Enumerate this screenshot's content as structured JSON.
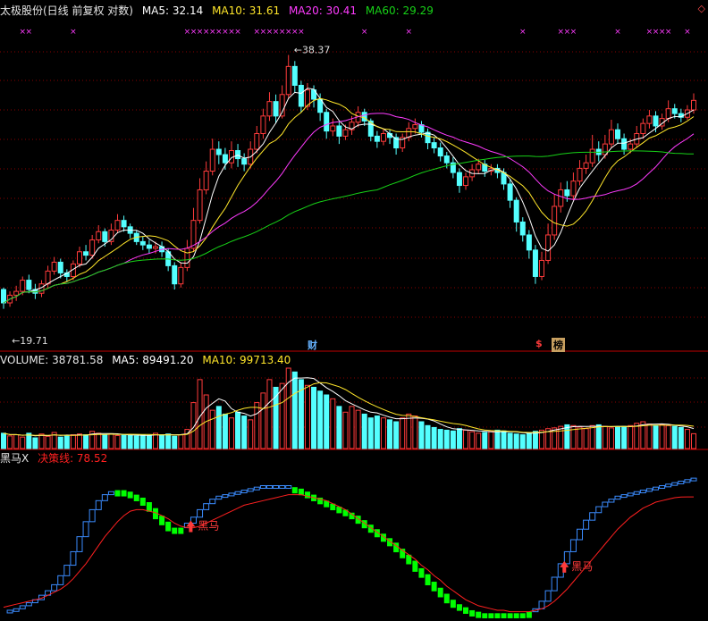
{
  "colors": {
    "up": "#ff3b3b",
    "down": "#54ffff",
    "ma5": "#ffffff",
    "ma10": "#ffe62a",
    "ma20": "#ff3bff",
    "ma60": "#17d117",
    "grid": "#8a0000",
    "blue_step": "#3b8cff",
    "green_step": "#00ff00",
    "decision": "#ff2020"
  },
  "price_header": {
    "title": "太极股份(日线 前复权 对数)",
    "ma5": "MA5: 32.14",
    "ma10": "MA10: 31.61",
    "ma20": "MA20: 30.41",
    "ma60": "MA60: 29.29"
  },
  "volume_header": {
    "volume": "VOLUME: 38781.58",
    "ma5": "MA5: 89491.20",
    "ma10": "MA10: 99713.40"
  },
  "indicator_header": {
    "name": "黑马X",
    "decision": "决策线: 78.52"
  },
  "annotations": {
    "high": "38.37",
    "low": "19.71",
    "cai": "财",
    "sou": "$",
    "bang": "榜",
    "heima_1": "黑马",
    "heima_2": "黑马"
  },
  "chart_data": {
    "type": "candlestick",
    "scale": "log",
    "ylim": [
      19.0,
      41.5
    ],
    "x_count": 110,
    "marks": [
      3,
      4,
      11,
      29,
      30,
      31,
      32,
      33,
      34,
      35,
      36,
      37,
      40,
      41,
      42,
      43,
      44,
      45,
      46,
      47,
      57,
      64,
      82,
      88,
      89,
      90,
      97,
      102,
      103,
      104,
      105,
      108
    ],
    "candles": [
      [
        21.5,
        20.8,
        21.6,
        20.5
      ],
      [
        20.8,
        21.2,
        21.4,
        20.6
      ],
      [
        21.2,
        21.4,
        21.7,
        20.9
      ],
      [
        21.4,
        22.0,
        22.2,
        21.2
      ],
      [
        22.0,
        21.5,
        22.3,
        21.3
      ],
      [
        21.5,
        21.3,
        21.8,
        21.0
      ],
      [
        21.3,
        21.8,
        22.0,
        21.1
      ],
      [
        21.8,
        22.5,
        22.8,
        21.6
      ],
      [
        22.5,
        23.0,
        23.3,
        22.3
      ],
      [
        23.0,
        22.4,
        23.2,
        22.1
      ],
      [
        22.4,
        22.2,
        22.6,
        21.9
      ],
      [
        22.2,
        22.9,
        23.1,
        22.0
      ],
      [
        22.9,
        23.6,
        23.9,
        22.7
      ],
      [
        23.6,
        23.4,
        24.0,
        23.1
      ],
      [
        23.4,
        24.3,
        24.6,
        23.2
      ],
      [
        24.3,
        24.8,
        25.2,
        24.1
      ],
      [
        24.8,
        24.2,
        25.0,
        23.9
      ],
      [
        24.2,
        24.9,
        25.3,
        24.0
      ],
      [
        24.9,
        25.5,
        25.9,
        24.7
      ],
      [
        25.5,
        25.1,
        25.8,
        24.8
      ],
      [
        25.1,
        24.7,
        25.3,
        24.4
      ],
      [
        24.7,
        24.2,
        24.9,
        24.0
      ],
      [
        24.2,
        24.0,
        24.5,
        23.7
      ],
      [
        24.0,
        23.8,
        24.3,
        23.5
      ],
      [
        23.8,
        23.9,
        24.2,
        23.5
      ],
      [
        23.9,
        23.6,
        24.2,
        23.3
      ],
      [
        23.6,
        22.8,
        23.8,
        22.5
      ],
      [
        22.8,
        21.8,
        23.0,
        21.5
      ],
      [
        21.8,
        22.7,
        23.0,
        21.6
      ],
      [
        22.7,
        23.8,
        24.3,
        22.5
      ],
      [
        23.8,
        25.5,
        26.3,
        23.6
      ],
      [
        25.5,
        27.5,
        28.3,
        25.3
      ],
      [
        27.5,
        28.8,
        29.5,
        27.2
      ],
      [
        28.8,
        30.4,
        31.2,
        28.5
      ],
      [
        30.4,
        30.0,
        31.0,
        29.3
      ],
      [
        30.0,
        29.4,
        30.5,
        28.9
      ],
      [
        29.4,
        30.3,
        31.0,
        29.0
      ],
      [
        30.3,
        29.7,
        30.8,
        29.1
      ],
      [
        29.7,
        29.3,
        30.1,
        28.8
      ],
      [
        29.3,
        30.4,
        31.0,
        29.0
      ],
      [
        30.4,
        31.6,
        32.2,
        30.1
      ],
      [
        31.6,
        33.0,
        33.6,
        31.2
      ],
      [
        33.0,
        34.2,
        35.0,
        32.6
      ],
      [
        34.2,
        33.0,
        34.8,
        32.4
      ],
      [
        33.0,
        34.8,
        35.6,
        32.8
      ],
      [
        34.8,
        37.3,
        38.37,
        34.5
      ],
      [
        37.3,
        35.6,
        37.8,
        35.0
      ],
      [
        35.6,
        33.8,
        36.0,
        33.3
      ],
      [
        33.8,
        35.2,
        35.8,
        33.5
      ],
      [
        35.2,
        34.4,
        35.6,
        33.7
      ],
      [
        34.4,
        33.3,
        34.9,
        32.6
      ],
      [
        33.3,
        31.8,
        33.6,
        31.2
      ],
      [
        31.8,
        32.2,
        32.8,
        31.4
      ],
      [
        32.2,
        31.4,
        32.6,
        30.8
      ],
      [
        31.4,
        31.9,
        32.3,
        31.1
      ],
      [
        31.9,
        32.5,
        33.0,
        31.5
      ],
      [
        32.5,
        33.3,
        33.8,
        32.1
      ],
      [
        33.3,
        32.6,
        33.6,
        32.2
      ],
      [
        32.6,
        31.4,
        32.8,
        31.0
      ],
      [
        31.4,
        31.0,
        31.8,
        30.5
      ],
      [
        31.0,
        31.6,
        32.0,
        30.7
      ],
      [
        31.6,
        31.3,
        31.9,
        30.8
      ],
      [
        31.3,
        30.5,
        31.6,
        30.0
      ],
      [
        30.5,
        31.3,
        31.6,
        30.2
      ],
      [
        31.3,
        32.0,
        32.5,
        31.0
      ],
      [
        32.0,
        32.3,
        32.8,
        31.6
      ],
      [
        32.3,
        31.7,
        32.6,
        31.3
      ],
      [
        31.7,
        30.9,
        32.0,
        30.4
      ],
      [
        30.9,
        30.5,
        31.3,
        30.1
      ],
      [
        30.5,
        29.9,
        30.9,
        29.5
      ],
      [
        29.9,
        29.4,
        30.2,
        29.0
      ],
      [
        29.4,
        28.7,
        29.8,
        28.3
      ],
      [
        28.7,
        27.8,
        29.0,
        27.3
      ],
      [
        27.8,
        28.4,
        28.7,
        27.5
      ],
      [
        28.4,
        28.9,
        29.3,
        28.1
      ],
      [
        28.9,
        29.3,
        29.7,
        28.6
      ],
      [
        29.3,
        28.8,
        29.6,
        28.4
      ],
      [
        28.8,
        29.0,
        29.3,
        28.5
      ],
      [
        29.0,
        28.7,
        29.3,
        28.3
      ],
      [
        28.7,
        27.9,
        29.0,
        27.5
      ],
      [
        27.9,
        26.8,
        28.2,
        26.3
      ],
      [
        26.8,
        25.4,
        27.0,
        24.8
      ],
      [
        25.4,
        24.6,
        25.7,
        24.2
      ],
      [
        24.6,
        23.7,
        24.9,
        23.2
      ],
      [
        23.7,
        22.2,
        24.0,
        21.8
      ],
      [
        22.2,
        23.1,
        23.6,
        22.0
      ],
      [
        23.1,
        24.6,
        25.3,
        22.9
      ],
      [
        24.6,
        26.4,
        27.2,
        24.3
      ],
      [
        26.4,
        27.5,
        28.0,
        26.0
      ],
      [
        27.5,
        27.1,
        28.1,
        26.7
      ],
      [
        27.1,
        28.1,
        28.7,
        26.8
      ],
      [
        28.1,
        29.0,
        29.6,
        27.8
      ],
      [
        29.0,
        29.4,
        30.0,
        28.6
      ],
      [
        29.4,
        30.4,
        31.5,
        29.1
      ],
      [
        30.4,
        30.0,
        31.0,
        29.5
      ],
      [
        30.0,
        30.8,
        31.5,
        29.7
      ],
      [
        30.8,
        31.9,
        32.7,
        30.5
      ],
      [
        31.9,
        31.2,
        32.4,
        30.8
      ],
      [
        31.2,
        30.4,
        31.6,
        30.0
      ],
      [
        30.4,
        30.8,
        31.2,
        30.1
      ],
      [
        30.8,
        31.6,
        32.2,
        30.5
      ],
      [
        31.6,
        32.4,
        32.8,
        31.2
      ],
      [
        32.4,
        33.0,
        33.5,
        32.0
      ],
      [
        33.0,
        32.2,
        33.4,
        31.7
      ],
      [
        32.2,
        32.8,
        33.2,
        31.9
      ],
      [
        32.8,
        33.6,
        34.3,
        32.5
      ],
      [
        33.6,
        33.2,
        34.0,
        32.8
      ],
      [
        33.2,
        32.9,
        33.6,
        32.5
      ],
      [
        32.9,
        33.5,
        33.9,
        32.7
      ],
      [
        33.5,
        34.3,
        34.9,
        33.2
      ]
    ],
    "volume_ylim": [
      0,
      210000
    ],
    "volume": [
      40000,
      33000,
      36000,
      30000,
      40000,
      28000,
      38000,
      32000,
      42000,
      30000,
      34000,
      36000,
      38000,
      36000,
      45000,
      40000,
      36000,
      38000,
      34000,
      35000,
      36000,
      33000,
      35000,
      34000,
      40000,
      36000,
      38000,
      32000,
      36000,
      50000,
      120000,
      180000,
      140000,
      100000,
      110000,
      90000,
      80000,
      95000,
      85000,
      75000,
      120000,
      145000,
      180000,
      160000,
      170000,
      210000,
      200000,
      180000,
      165000,
      160000,
      150000,
      140000,
      130000,
      110000,
      95000,
      110000,
      100000,
      90000,
      80000,
      85000,
      80000,
      75000,
      70000,
      80000,
      90000,
      85000,
      70000,
      60000,
      55000,
      50000,
      48000,
      46000,
      52000,
      48000,
      44000,
      40000,
      42000,
      45000,
      48000,
      46000,
      40000,
      38000,
      36000,
      42000,
      45000,
      48000,
      52000,
      54000,
      58000,
      62000,
      60000,
      56000,
      52000,
      60000,
      62000,
      58000,
      54000,
      56000,
      58000,
      60000,
      66000,
      70000,
      64000,
      60000,
      62000,
      60000,
      58000,
      55000,
      50000,
      38781.58
    ],
    "ind_ylim": [
      0,
      100
    ],
    "ind_decision": [
      5,
      6,
      7,
      8,
      9,
      10,
      11,
      13,
      15,
      17,
      20,
      24,
      29,
      34,
      40,
      46,
      52,
      57,
      62,
      66,
      69,
      70,
      70,
      69,
      68,
      66,
      64,
      61,
      59,
      58,
      58,
      59,
      61,
      63,
      65,
      67,
      69,
      71,
      73,
      74,
      75,
      76,
      77,
      78,
      79,
      80,
      80,
      80,
      79,
      78,
      77,
      76,
      74,
      72,
      70,
      67,
      64,
      61,
      58,
      55,
      52,
      49,
      46,
      43,
      40,
      37,
      33,
      30,
      26,
      23,
      19,
      16,
      13,
      10,
      8,
      6,
      5,
      4,
      3,
      3,
      2,
      2,
      2,
      2,
      3,
      4,
      6,
      9,
      13,
      17,
      22,
      27,
      32,
      37,
      42,
      47,
      52,
      57,
      61,
      65,
      68,
      71,
      73,
      75,
      76,
      77,
      78,
      78.4,
      78.52,
      78.52
    ],
    "ind_fast": [
      2,
      3,
      4,
      6,
      8,
      10,
      13,
      16,
      20,
      26,
      33,
      42,
      52,
      62,
      70,
      76,
      80,
      82,
      83,
      82,
      80,
      78,
      75,
      71,
      66,
      62,
      58,
      57,
      58,
      61,
      65,
      70,
      74,
      77,
      79,
      80,
      81,
      82,
      83,
      84,
      85,
      86,
      86,
      86,
      86,
      85,
      84,
      82,
      80,
      78,
      76,
      74,
      72,
      70,
      68,
      66,
      63,
      60,
      57,
      54,
      51,
      48,
      44,
      40,
      36,
      31,
      27,
      22,
      18,
      14,
      10,
      7,
      5,
      3,
      2,
      1,
      1,
      1,
      1,
      1,
      1,
      1,
      1,
      2,
      4,
      9,
      16,
      25,
      34,
      42,
      50,
      57,
      63,
      68,
      72,
      75,
      77,
      79,
      80,
      81,
      82,
      83,
      84,
      85,
      86,
      87,
      88,
      89,
      90,
      91
    ],
    "ind_green_ranges": [
      [
        18,
        28
      ],
      [
        46,
        83
      ]
    ],
    "heima_signals": [
      29,
      88
    ]
  }
}
